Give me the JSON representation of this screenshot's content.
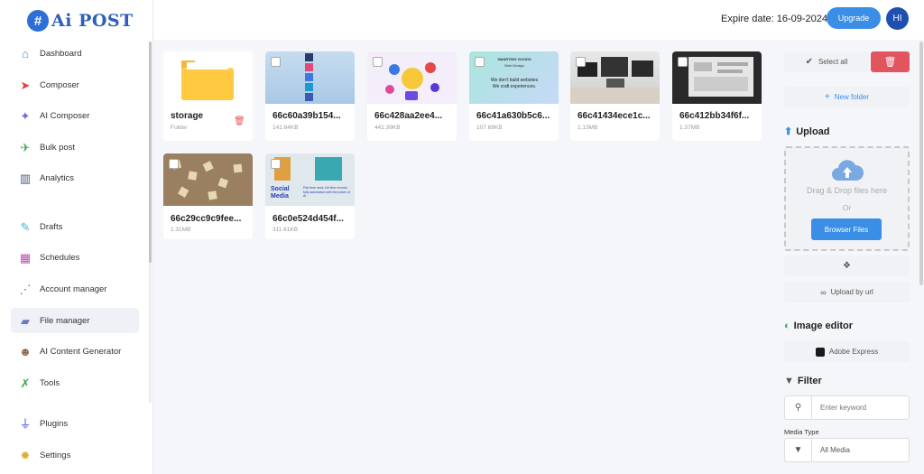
{
  "brand": {
    "badge": "#",
    "name": "Ai POST"
  },
  "header": {
    "expire_label": "Expire date: 16-09-2024",
    "upgrade_label": "Upgrade",
    "avatar_initials": "HI"
  },
  "sidebar": {
    "items": [
      {
        "id": "dashboard",
        "label": "Dashboard",
        "icon": "house-icon"
      },
      {
        "id": "composer",
        "label": "Composer",
        "icon": "send-icon"
      },
      {
        "id": "ai-composer",
        "label": "AI Composer",
        "icon": "ai-icon"
      },
      {
        "id": "bulk-post",
        "label": "Bulk post",
        "icon": "rocket-icon"
      },
      {
        "id": "analytics",
        "label": "Analytics",
        "icon": "chart-icon"
      },
      {
        "id": "drafts",
        "label": "Drafts",
        "icon": "draft-icon"
      },
      {
        "id": "schedules",
        "label": "Schedules",
        "icon": "calendar-icon"
      },
      {
        "id": "account-manager",
        "label": "Account manager",
        "icon": "share-icon"
      },
      {
        "id": "file-manager",
        "label": "File manager",
        "icon": "folder-icon",
        "active": true
      },
      {
        "id": "ai-content-generator",
        "label": "AI Content Generator",
        "icon": "robot-icon"
      },
      {
        "id": "tools",
        "label": "Tools",
        "icon": "tools-icon"
      },
      {
        "id": "plugins",
        "label": "Plugins",
        "icon": "plug-icon"
      },
      {
        "id": "settings",
        "label": "Settings",
        "icon": "gear-icon"
      }
    ]
  },
  "files": [
    {
      "name": "storage",
      "meta": "Folder",
      "type": "folder"
    },
    {
      "name": "66c60a39b154...",
      "meta": "141.64KB",
      "type": "image"
    },
    {
      "name": "66c428aa2ee4...",
      "meta": "441.39KB",
      "type": "image"
    },
    {
      "name": "66c41a630b5c6...",
      "meta": "107.69KB",
      "type": "image",
      "thumb_title": "SMARTING GOODS",
      "thumb_sub": "Web Design",
      "thumb_line1": "We don't build websites",
      "thumb_line2": "We craft experiences."
    },
    {
      "name": "66c41434ece1c...",
      "meta": "1.13MB",
      "type": "image"
    },
    {
      "name": "66c412bb34f6f...",
      "meta": "1.37MB",
      "type": "image"
    },
    {
      "name": "66c29cc9c9fee...",
      "meta": "1.31MB",
      "type": "image"
    },
    {
      "name": "66c0e524d454f...",
      "meta": "311.61KB",
      "type": "image",
      "thumb_title": "Social Media",
      "thumb_sub": "Part time work, full time income, fully automation with the power of AI"
    }
  ],
  "panel": {
    "select_all": "Select all",
    "new_folder": "New folder",
    "upload_title": "Upload",
    "drag_drop": "Drag & Drop files here",
    "or": "Or",
    "browse": "Browser Files",
    "upload_url": "Upload by url",
    "image_editor_title": "Image editor",
    "adobe_express": "Adobe Express",
    "filter_title": "Filter",
    "keyword_placeholder": "Enter keyword",
    "media_type_label": "Media Type",
    "media_type_value": "All Media"
  },
  "colors": {
    "accent": "#3a8ee6",
    "danger": "#e2555e",
    "brand": "#2d5fb8"
  }
}
